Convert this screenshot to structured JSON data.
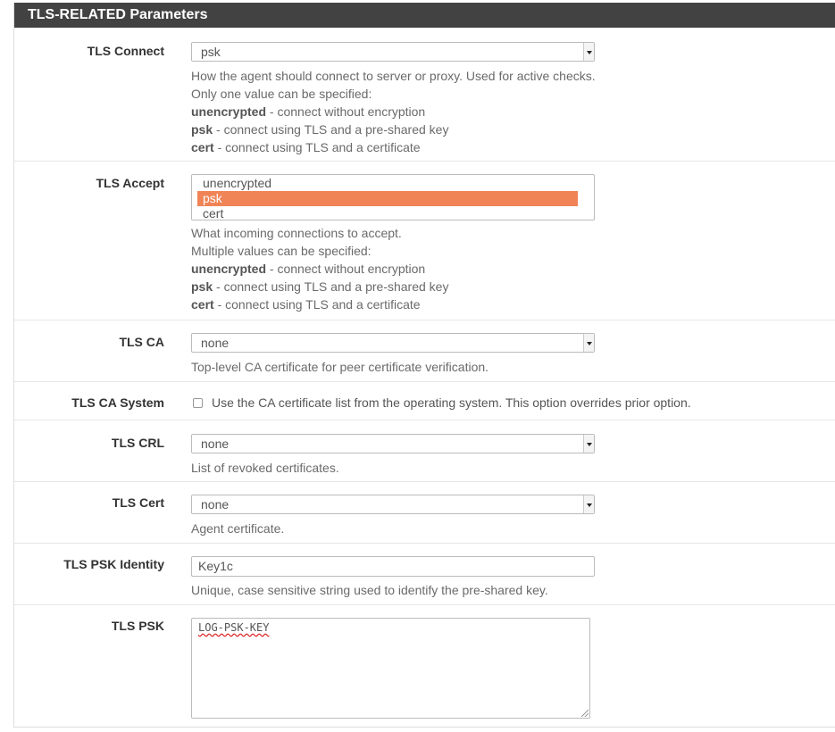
{
  "panel": {
    "title": "TLS-RELATED Parameters"
  },
  "tls_connect": {
    "label": "TLS Connect",
    "value": "psk",
    "help": [
      "How the agent should connect to server or proxy. Used for active checks.",
      "Only one value can be specified:"
    ],
    "options_help": [
      {
        "term": "unencrypted",
        "desc": " - connect without encryption"
      },
      {
        "term": "psk",
        "desc": " - connect using TLS and a pre-shared key"
      },
      {
        "term": "cert",
        "desc": " - connect using TLS and a certificate"
      }
    ]
  },
  "tls_accept": {
    "label": "TLS Accept",
    "options": [
      "unencrypted",
      "psk",
      "cert"
    ],
    "selected": "psk",
    "help": [
      "What incoming connections to accept.",
      "Multiple values can be specified:"
    ],
    "options_help": [
      {
        "term": "unencrypted",
        "desc": " - connect without encryption"
      },
      {
        "term": "psk",
        "desc": " - connect using TLS and a pre-shared key"
      },
      {
        "term": "cert",
        "desc": " - connect using TLS and a certificate"
      }
    ]
  },
  "tls_ca": {
    "label": "TLS CA",
    "value": "none",
    "help": "Top-level CA certificate for peer certificate verification."
  },
  "tls_ca_system": {
    "label": "TLS CA System",
    "checked": false,
    "text": "Use the CA certificate list from the operating system. This option overrides prior option."
  },
  "tls_crl": {
    "label": "TLS CRL",
    "value": "none",
    "help": "List of revoked certificates."
  },
  "tls_cert": {
    "label": "TLS Cert",
    "value": "none",
    "help": "Agent certificate."
  },
  "tls_psk_identity": {
    "label": "TLS PSK Identity",
    "value": "Key1c",
    "help": "Unique, case sensitive string used to identify the pre-shared key."
  },
  "tls_psk": {
    "label": "TLS PSK",
    "value": "LOG-PSK-KEY"
  },
  "colors": {
    "heading_bg": "#424242",
    "selected_option": "#f08457"
  }
}
